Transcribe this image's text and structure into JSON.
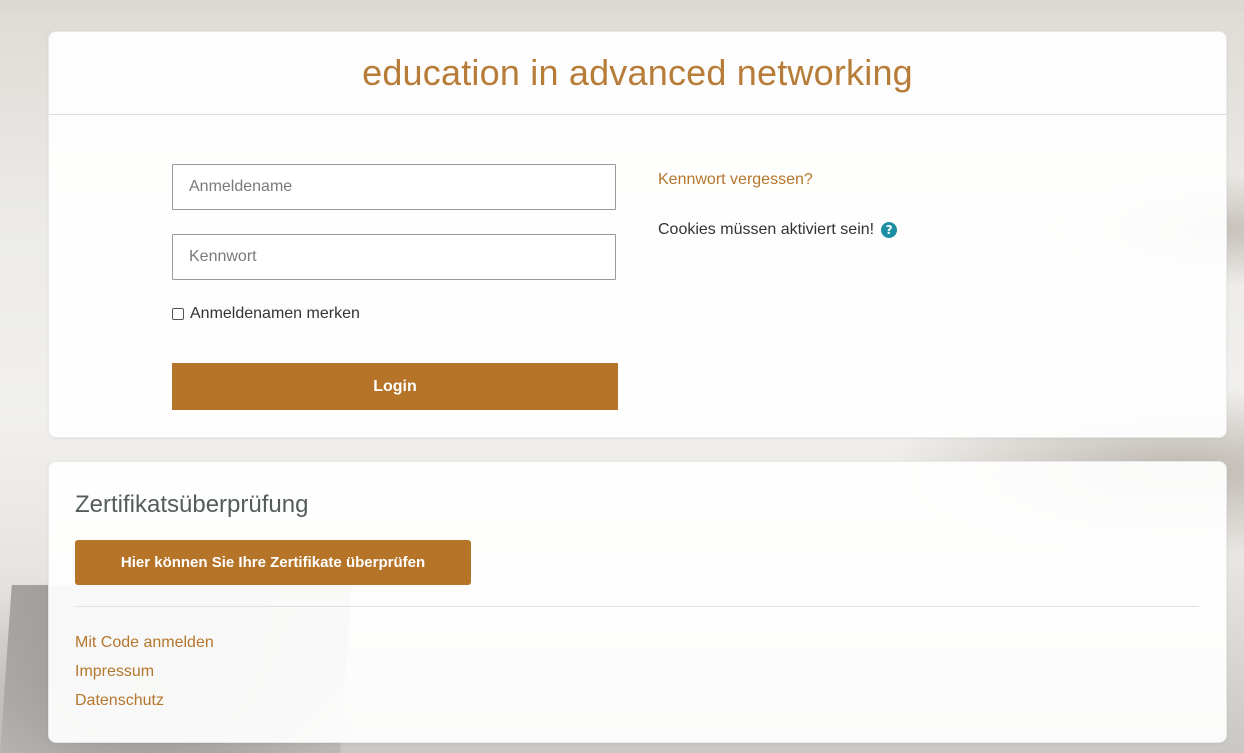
{
  "login": {
    "site_title": "education in advanced networking",
    "username_placeholder": "Anmeldename",
    "password_placeholder": "Kennwort",
    "remember_label": "Anmeldenamen merken",
    "login_button": "Login",
    "forgot_password": "Kennwort vergessen?",
    "cookies_notice": "Cookies müssen aktiviert sein!",
    "help_icon_glyph": "?"
  },
  "certificate": {
    "title": "Zertifikatsüberprüfung",
    "verify_button": "Hier können Sie Ihre Zertifikate überprüfen"
  },
  "footer": {
    "links": [
      "Mit Code anmelden",
      "Impressum",
      "Datenschutz"
    ]
  },
  "colors": {
    "accent": "#b57428",
    "title": "#b77c38",
    "help_icon": "#1c8fa3"
  },
  "icons": {
    "help": "question-circle-icon",
    "checkbox": "checkbox-unchecked-icon"
  }
}
